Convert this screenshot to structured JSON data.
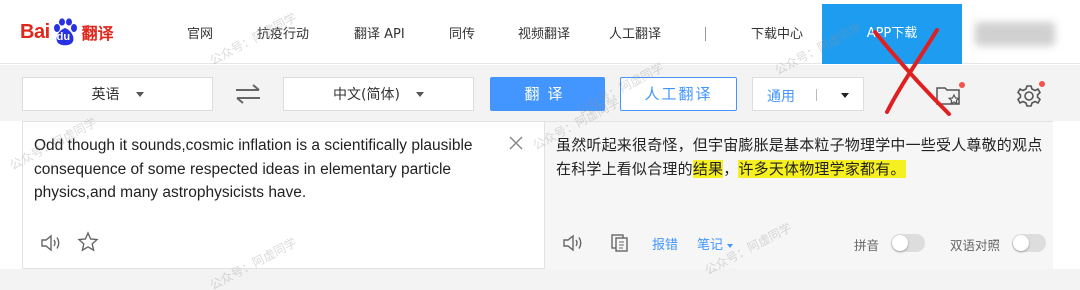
{
  "header": {
    "logo": {
      "bai": "Bai",
      "du": "du",
      "fanyi": "翻译"
    },
    "nav": [
      {
        "label": "官网"
      },
      {
        "label": "抗疫行动"
      },
      {
        "label": "翻译 API"
      },
      {
        "label": "同传"
      },
      {
        "label": "视频翻译"
      },
      {
        "label": "人工翻译"
      },
      {
        "label": "下载中心"
      }
    ],
    "app_download": "APP下载"
  },
  "toolbar": {
    "source_lang": "英语",
    "target_lang": "中文(简体)",
    "translate_button": "翻译",
    "human_translate_button": "人工翻译",
    "domain": "通用"
  },
  "source": {
    "text": "Odd though it sounds,cosmic inflation is a scientifically plausible consequence of some respected ideas in elementary particle physics,and many astrophysicists have."
  },
  "target": {
    "text_plain": "虽然听起来很奇怪，但宇宙膨胀是基本粒子物理学中一些受人尊敬的观点在科学上看似合理的",
    "highlight_1": "结果",
    "separator": "，",
    "highlight_2": "许多天体物理学家都有。",
    "report_error": "报错",
    "notes": "笔记",
    "pinyin_label": "拼音",
    "bilingual_label": "双语对照"
  },
  "watermark": {
    "text": "公众号：阿虚同学"
  },
  "colors": {
    "brand_red": "#e1261c",
    "accent_blue": "#4395ff",
    "app_download_bg": "#1e9cf0",
    "highlight": "#f7f020"
  }
}
